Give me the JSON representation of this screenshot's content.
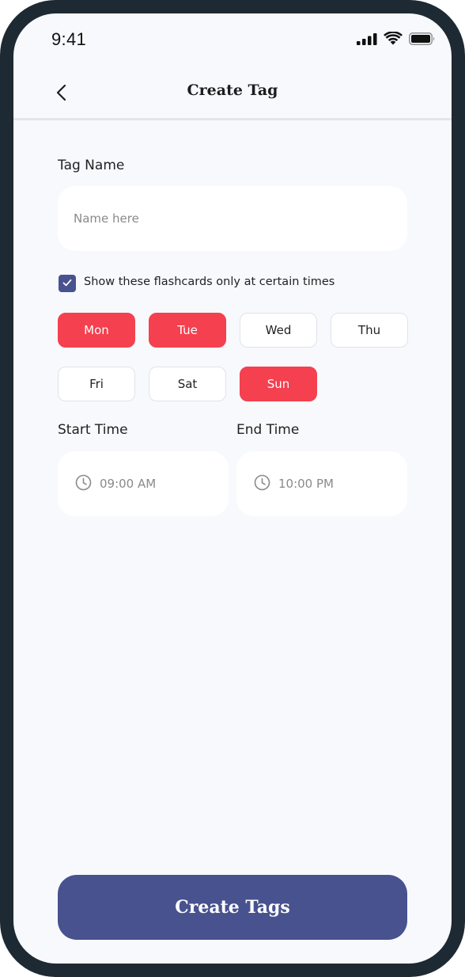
{
  "status_bar": {
    "time": "9:41"
  },
  "header": {
    "title": "Create Tag",
    "back_icon": "chevron-left-icon"
  },
  "form": {
    "tag_name_label": "Tag Name",
    "tag_name_value": "",
    "tag_name_placeholder": "Name here",
    "schedule_checkbox": {
      "checked": true,
      "label": "Show these flashcards only at certain times"
    },
    "days": [
      {
        "label": "Mon",
        "selected": true
      },
      {
        "label": "Tue",
        "selected": true
      },
      {
        "label": "Wed",
        "selected": false
      },
      {
        "label": "Thu",
        "selected": false
      },
      {
        "label": "Fri",
        "selected": false
      },
      {
        "label": "Sat",
        "selected": false
      },
      {
        "label": "Sun",
        "selected": true
      }
    ],
    "start_time_label": "Start Time",
    "start_time_value": "09:00 AM",
    "end_time_label": "End Time",
    "end_time_value": "10:00 PM"
  },
  "actions": {
    "create_label": "Create Tags"
  },
  "colors": {
    "accent_red": "#f4404f",
    "primary_indigo": "#48528f",
    "frame": "#1e2a33",
    "background": "#f8f9fd"
  }
}
